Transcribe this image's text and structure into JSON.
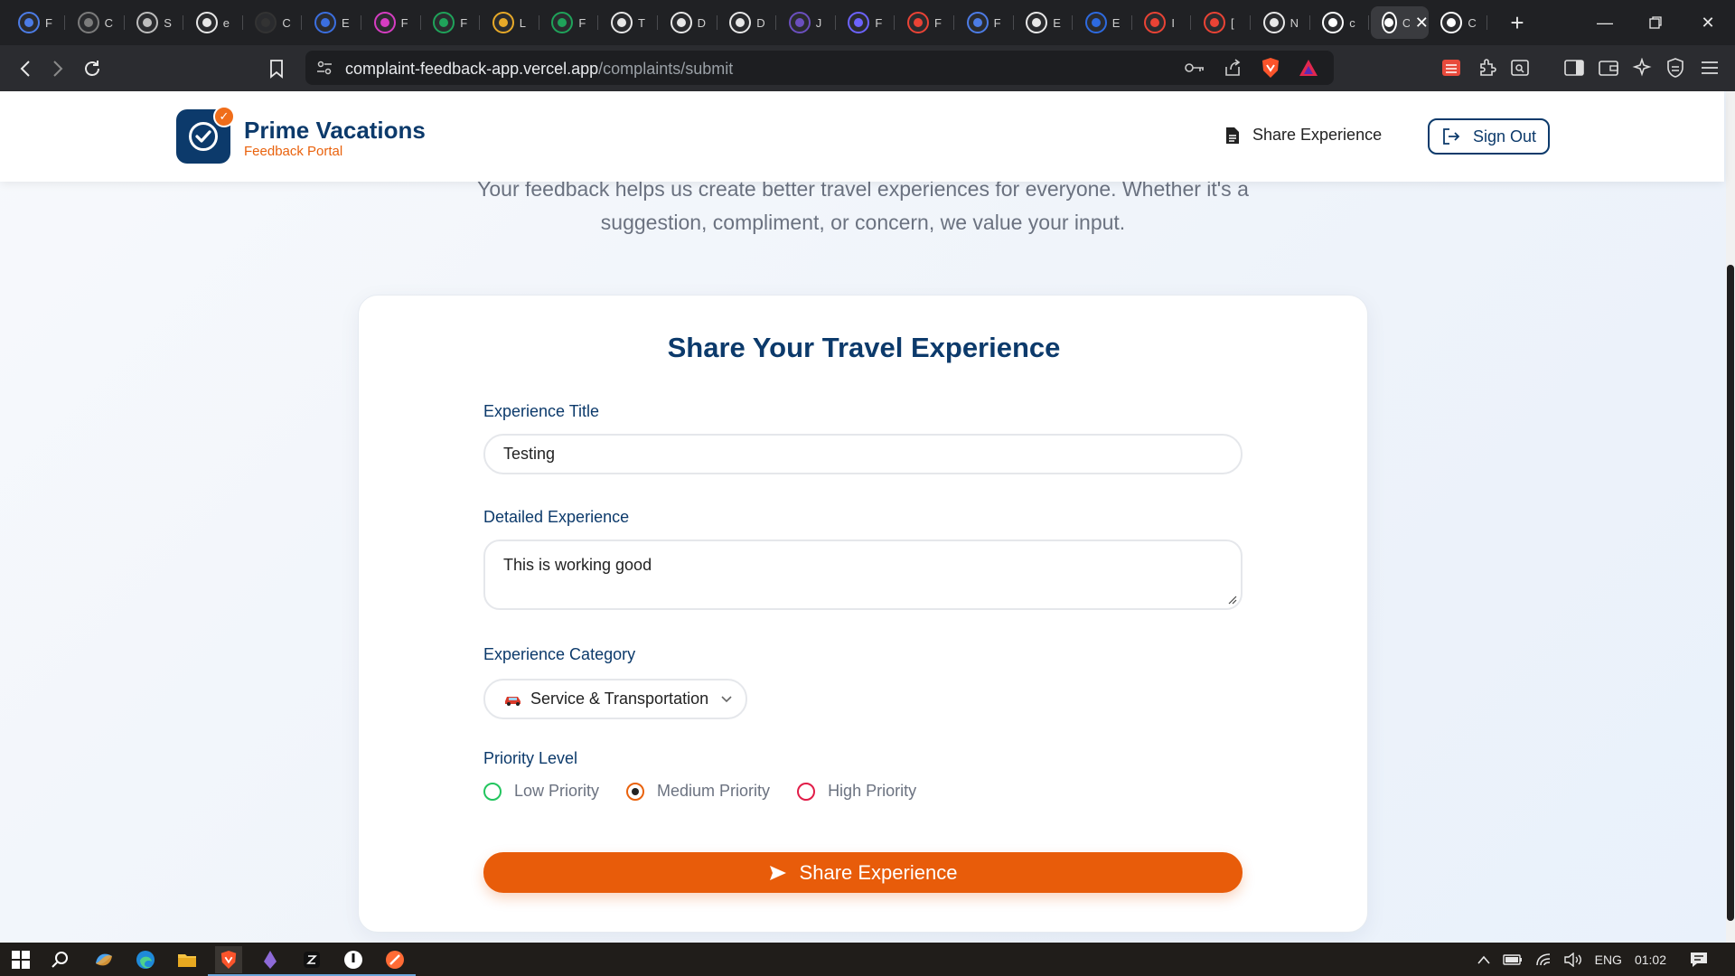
{
  "browser": {
    "tabs": [
      {
        "icon": "doc-circle-icon",
        "color": "#4c7ce6",
        "letter": "F"
      },
      {
        "icon": "gear-circle-icon",
        "color": "#7c7c7c",
        "letter": "C"
      },
      {
        "icon": "circle-icon",
        "color": "#bdbdbd",
        "letter": "S"
      },
      {
        "icon": "github-icon",
        "color": "#e8e8e8",
        "letter": "e"
      },
      {
        "icon": "n-circle-icon",
        "color": "#333333",
        "letter": "C"
      },
      {
        "icon": "bird-icon",
        "color": "#3b6fe0",
        "letter": "E"
      },
      {
        "icon": "chat-icon",
        "color": "#d63dc2",
        "letter": "F"
      },
      {
        "icon": "leaf-icon",
        "color": "#1fa35a",
        "letter": "F"
      },
      {
        "icon": "color-grid-icon",
        "color": "#e7a928",
        "letter": "L"
      },
      {
        "icon": "leaf-icon",
        "color": "#1fa35a",
        "letter": "F"
      },
      {
        "icon": "hexagon-icon",
        "color": "#e8e8e8",
        "letter": "T"
      },
      {
        "icon": "hexagon-icon",
        "color": "#e8e8e8",
        "letter": "D"
      },
      {
        "icon": "hexagon-icon",
        "color": "#e8e8e8",
        "letter": "D"
      },
      {
        "icon": "dots-circle-icon",
        "color": "#6b4fbf",
        "letter": "J"
      },
      {
        "icon": "list-circle-icon",
        "color": "#6c63ff",
        "letter": "F"
      },
      {
        "icon": "google-icon",
        "color": "#ea4335",
        "letter": "F"
      },
      {
        "icon": "doc-circle-icon",
        "color": "#4c7ce6",
        "letter": "F"
      },
      {
        "icon": "github-icon",
        "color": "#e8e8e8",
        "letter": "E"
      },
      {
        "icon": "globe-icon",
        "color": "#2d6ae0",
        "letter": "E"
      },
      {
        "icon": "gmail-icon",
        "color": "#ea4335",
        "letter": "I"
      },
      {
        "icon": "gmail-icon",
        "color": "#ea4335",
        "letter": "["
      },
      {
        "icon": "github-icon",
        "color": "#e8e8e8",
        "letter": "N"
      },
      {
        "icon": "triangle-icon",
        "color": "#ffffff",
        "letter": "c"
      },
      {
        "icon": "triangle-icon",
        "color": "#ffffff",
        "letter": "C",
        "active": true
      },
      {
        "icon": "triangle-icon",
        "color": "#ffffff",
        "letter": "C"
      }
    ],
    "url_host": "complaint-feedback-app.vercel.app",
    "url_path": "/complaints/submit"
  },
  "header": {
    "brand_name": "Prime Vacations",
    "brand_sub": "Feedback Portal",
    "nav_share": "Share Experience",
    "sign_out": "Sign Out"
  },
  "intro": "Your feedback helps us create better travel experiences for everyone. Whether it's a suggestion, compliment, or concern, we value your input.",
  "form": {
    "title": "Share Your Travel Experience",
    "title_label": "Experience Title",
    "title_value": "Testing",
    "detail_label": "Detailed Experience",
    "detail_value": "This is working good",
    "category_label": "Experience Category",
    "category_value": "Service & Transportation",
    "priority_label": "Priority Level",
    "priorities": [
      {
        "label": "Low Priority",
        "color": "#22c55e",
        "selected": false
      },
      {
        "label": "Medium Priority",
        "color": "#e9620d",
        "selected": true
      },
      {
        "label": "High Priority",
        "color": "#e11d48",
        "selected": false
      }
    ],
    "submit": "Share Experience"
  },
  "taskbar": {
    "tray_lang": "ENG",
    "tray_time": "01:02"
  },
  "colors": {
    "brand": "#0c3a6b",
    "accent": "#e85c0a"
  }
}
